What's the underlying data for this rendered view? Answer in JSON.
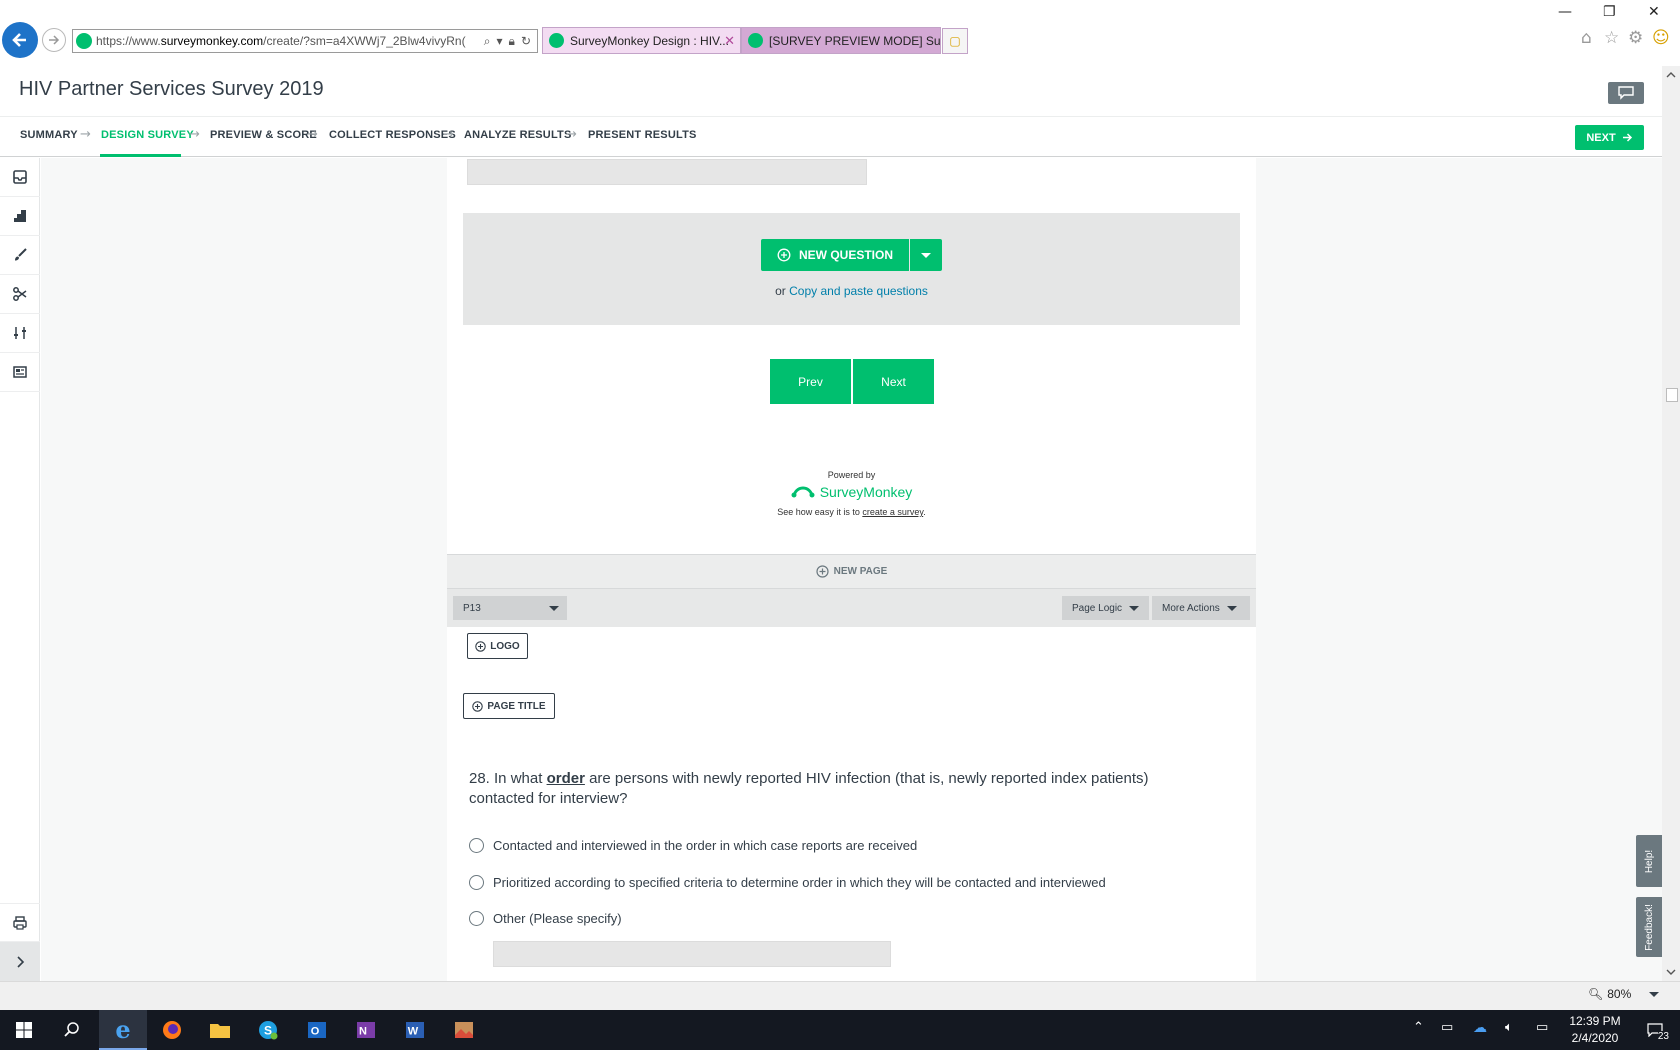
{
  "browser": {
    "url_host_prefix": "https://www.",
    "url_host": "surveymonkey.com",
    "url_path": "/create/?sm=a4XWWj7_2Blw4vivyRn(",
    "tabs": [
      {
        "label": "SurveyMonkey Design : HIV..."
      },
      {
        "label": "[SURVEY PREVIEW MODE] Surv..."
      }
    ]
  },
  "header": {
    "title": "HIV Partner Services Survey 2019"
  },
  "nav": {
    "items": [
      {
        "label": "SUMMARY"
      },
      {
        "label": "DESIGN SURVEY"
      },
      {
        "label": "PREVIEW & SCORE"
      },
      {
        "label": "COLLECT RESPONSES"
      },
      {
        "label": "ANALYZE RESULTS"
      },
      {
        "label": "PRESENT RESULTS"
      }
    ],
    "next_label": "NEXT"
  },
  "builder": {
    "new_question_label": "NEW QUESTION",
    "copy_prefix": "or ",
    "copy_link": "Copy and paste questions",
    "prev_label": "Prev",
    "next_label": "Next",
    "powered_by": "Powered by",
    "brand": "SurveyMonkey",
    "easy_prefix": "See how easy it is to ",
    "easy_link": "create a survey",
    "easy_suffix": ".",
    "new_page_label": "NEW PAGE",
    "page_select": "P13",
    "page_logic_label": "Page Logic",
    "more_actions_label": "More Actions",
    "logo_label": "LOGO",
    "page_title_label": "PAGE TITLE"
  },
  "question": {
    "number_prefix": "28. In what ",
    "emphasis": "order",
    "text_rest": " are persons with newly reported HIV infection (that is, newly reported index patients) contacted for interview?",
    "options": [
      {
        "label": "Contacted and interviewed in the order in which case reports are received"
      },
      {
        "label": "Prioritized according to specified criteria to determine order in which they will be contacted and interviewed"
      },
      {
        "label": "Other  (Please specify)"
      }
    ]
  },
  "side_tabs": {
    "help": "Help!",
    "feedback": "Feedback!"
  },
  "status": {
    "zoom": "80%"
  },
  "taskbar": {
    "time": "12:39 PM",
    "date": "2/4/2020",
    "notification_count": "23"
  },
  "colors": {
    "brand_green": "#00bf6f",
    "text_dark": "#333e48",
    "link_blue": "#007faa"
  }
}
